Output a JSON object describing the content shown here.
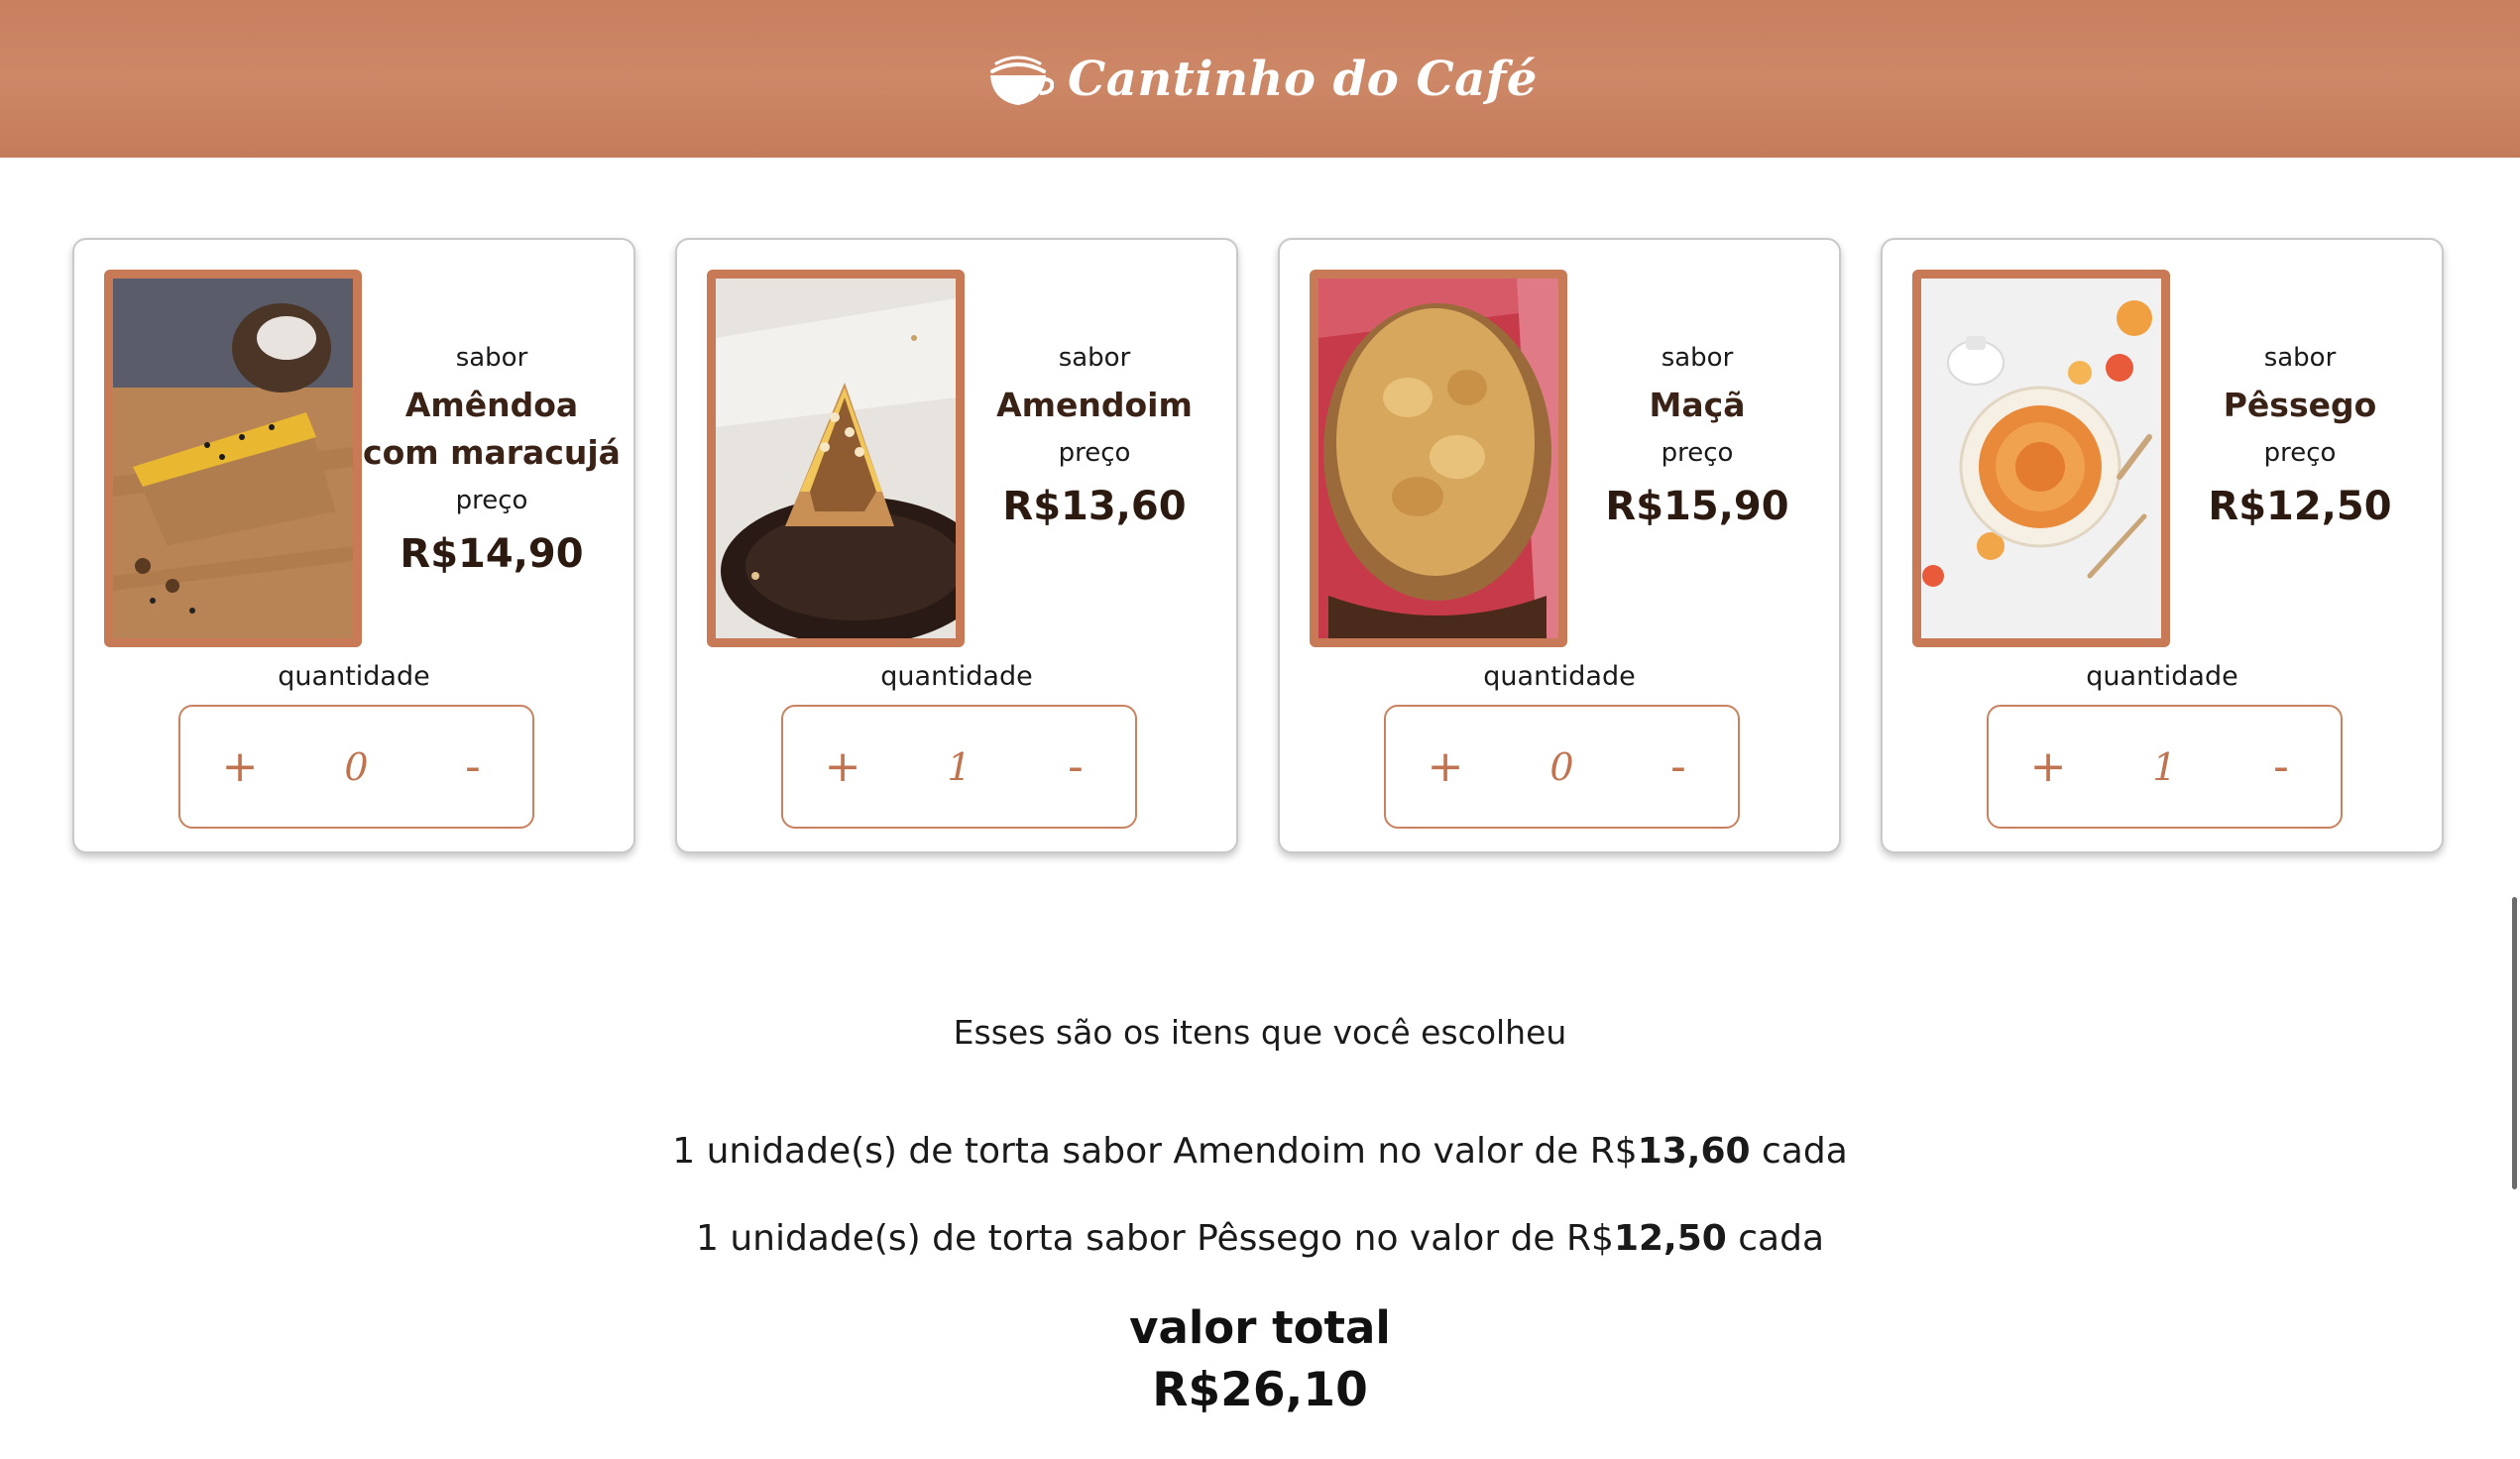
{
  "header": {
    "brand_name": "Cantinho do Café",
    "icon": "coffee-cup-icon",
    "background_color": "#c8805f"
  },
  "products": [
    {
      "image": "almond-passionfruit-pie-photo",
      "flavor_label": "sabor",
      "flavor": "Amêndoa com maracujá",
      "price_label": "preço",
      "price": "R$14,90",
      "quantity_label": "quantidade",
      "plus": "+",
      "quantity": "0",
      "minus": "-"
    },
    {
      "image": "peanut-pie-slice-photo",
      "flavor_label": "sabor",
      "flavor": "Amendoim",
      "price_label": "preço",
      "price": "R$13,60",
      "quantity_label": "quantidade",
      "plus": "+",
      "quantity": "1",
      "minus": "-"
    },
    {
      "image": "apple-pie-photo",
      "flavor_label": "sabor",
      "flavor": "Maçã",
      "price_label": "preço",
      "price": "R$15,90",
      "quantity_label": "quantidade",
      "plus": "+",
      "quantity": "0",
      "minus": "-"
    },
    {
      "image": "peach-tart-photo",
      "flavor_label": "sabor",
      "flavor": "Pêssego",
      "price_label": "preço",
      "price": "R$12,50",
      "quantity_label": "quantidade",
      "plus": "+",
      "quantity": "1",
      "minus": "-"
    }
  ],
  "summary": {
    "heading": "Esses são os itens que você escolheu",
    "items": [
      {
        "prefix": "1 unidade(s) de torta sabor Amendoim no valor de R$",
        "price": "13,60",
        "suffix": " cada"
      },
      {
        "prefix": "1 unidade(s) de torta sabor Pêssego no valor de R$",
        "price": "12,50",
        "suffix": " cada"
      }
    ],
    "total_label": "valor total",
    "total_value": "R$26,10"
  },
  "colors": {
    "accent": "#c87a56",
    "stepper_text": "#c0734f"
  }
}
